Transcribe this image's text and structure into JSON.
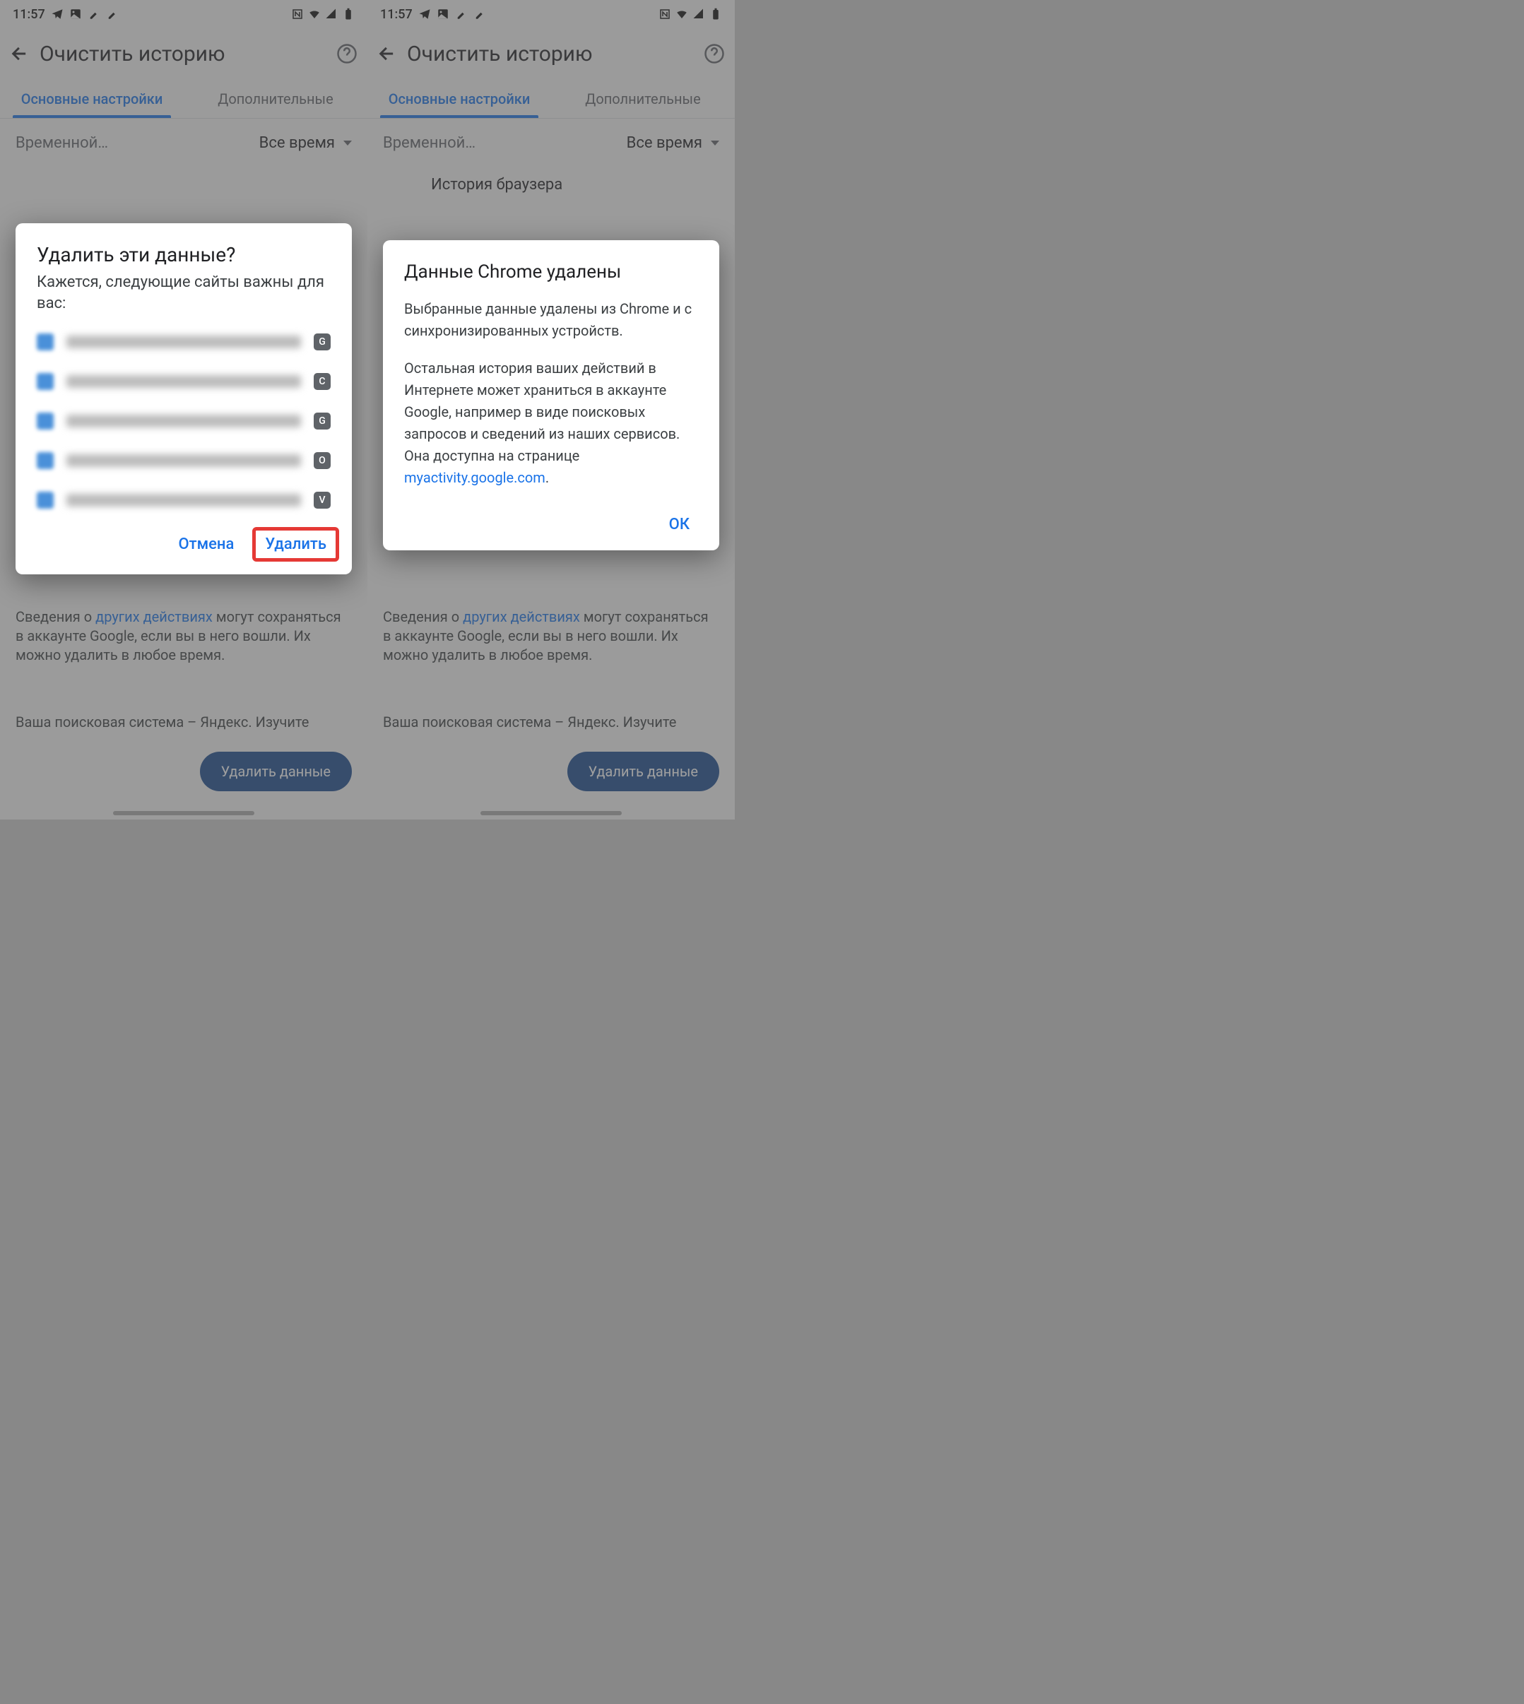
{
  "status": {
    "time": "11:57"
  },
  "appbar": {
    "title": "Очистить историю"
  },
  "tabs": {
    "basic": "Основные настройки",
    "advanced": "Дополнительные"
  },
  "range": {
    "label": "Временной…",
    "value": "Все время"
  },
  "history_section": "История браузера",
  "footer": {
    "pre": "Сведения о ",
    "link": "других действиях",
    "post": " могут сохраняться в аккаунте Google, если вы в него вошли. Их можно удалить в любое время."
  },
  "search_engine": "Ваша поисковая система – Яндекс. Изучите",
  "delete_btn": "Удалить данные",
  "dialog1": {
    "title": "Удалить эти данные?",
    "subtitle": "Кажется, следующие сайты важны для вас:",
    "badges": [
      "G",
      "C",
      "G",
      "O",
      "V"
    ],
    "cancel": "Отмена",
    "confirm": "Удалить"
  },
  "dialog2": {
    "title": "Данные Chrome удалены",
    "p1": "Выбранные данные удалены из Chrome и с синхронизированных устройств.",
    "p2_pre": "Остальная история ваших действий в Интернете может храниться в аккаунте Google, например в виде поисковых запросов и сведений из наших сервисов. Она доступна на странице ",
    "p2_link": "myactivity.google.com",
    "p2_post": ".",
    "ok": "ОК"
  }
}
